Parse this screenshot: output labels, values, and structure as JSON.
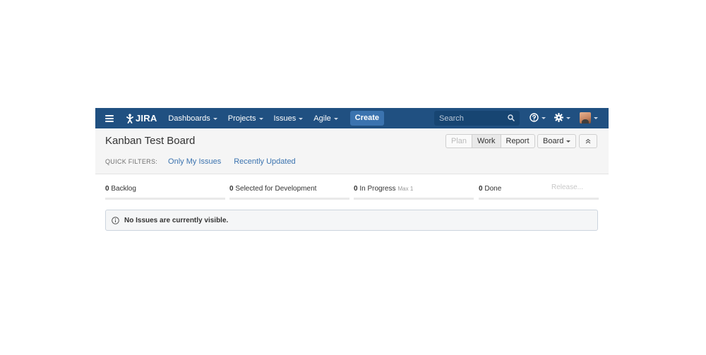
{
  "header": {
    "logo_text": "JIRA",
    "nav": [
      {
        "label": "Dashboards"
      },
      {
        "label": "Projects"
      },
      {
        "label": "Issues"
      },
      {
        "label": "Agile"
      }
    ],
    "create_label": "Create",
    "search": {
      "placeholder": "Search"
    }
  },
  "board": {
    "title": "Kanban Test Board",
    "modes": [
      "Plan",
      "Work",
      "Report"
    ],
    "board_menu_label": "Board",
    "quick_filters_label": "QUICK FILTERS:",
    "quick_filters": [
      "Only My Issues",
      "Recently Updated"
    ]
  },
  "columns": [
    {
      "count": "0",
      "name": "Backlog"
    },
    {
      "count": "0",
      "name": "Selected for Development"
    },
    {
      "count": "0",
      "name": "In Progress",
      "max": "Max 1"
    },
    {
      "count": "0",
      "name": "Done"
    }
  ],
  "release_label": "Release...",
  "message": "No Issues are currently visible.",
  "colors": {
    "topbar": "#205081",
    "create": "#3b73af",
    "link": "#3b73af"
  }
}
